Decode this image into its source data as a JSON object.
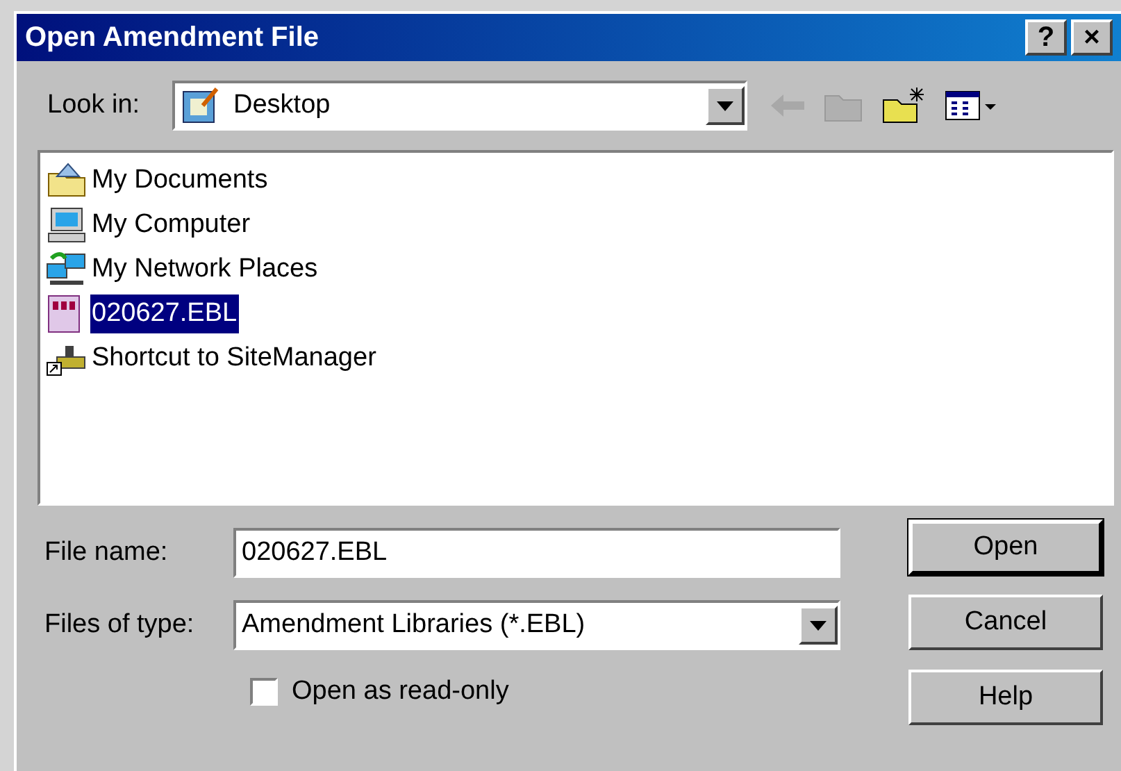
{
  "window": {
    "title": "Open Amendment File",
    "title_buttons": [
      "?",
      "×"
    ]
  },
  "look_in": {
    "label": "Look in:",
    "value": "Desktop"
  },
  "toolbar": [
    {
      "kind": "back",
      "disabled": true
    },
    {
      "kind": "up",
      "disabled": true
    },
    {
      "kind": "new_folder",
      "disabled": false
    },
    {
      "kind": "view",
      "disabled": false
    }
  ],
  "files": [
    {
      "name": "My Documents",
      "kind": "documents",
      "selected": false
    },
    {
      "name": "My Computer",
      "kind": "computer",
      "selected": false
    },
    {
      "name": "My Network Places",
      "kind": "network",
      "selected": false
    },
    {
      "name": "020627.EBL",
      "kind": "ebl",
      "selected": true
    },
    {
      "name": "Shortcut to SiteManager",
      "kind": "shortcut",
      "selected": false
    }
  ],
  "file_name": {
    "label": "File name:",
    "value": "020627.EBL"
  },
  "file_type": {
    "label": "Files of type:",
    "value": "Amendment Libraries (*.EBL)"
  },
  "read_only": {
    "label": "Open as read-only",
    "checked": false
  },
  "buttons": [
    {
      "label": "Open",
      "default": true
    },
    {
      "label": "Cancel",
      "default": false
    },
    {
      "label": "Help",
      "default": false
    }
  ]
}
